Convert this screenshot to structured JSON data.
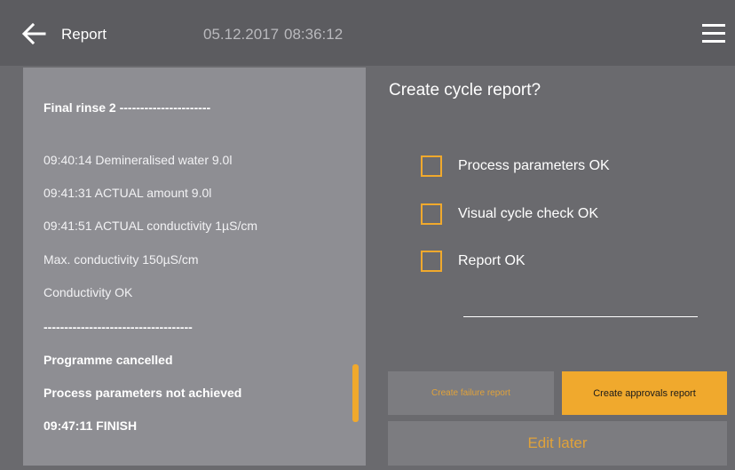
{
  "header": {
    "title": "Report",
    "date": "05.12.2017",
    "time": "08:36:12",
    "back_icon": "arrow-left-icon",
    "menu_icon": "hamburger-menu-icon"
  },
  "log": {
    "lines": [
      {
        "text": "Final rinse 2 ----------------------",
        "bold": true
      },
      {
        "text": "09:40:14 Demineralised water 9.0l",
        "bold": false
      },
      {
        "text": "09:41:31 ACTUAL amount 9.0l",
        "bold": false
      },
      {
        "text": "09:41:51 ACTUAL conductivity 1µS/cm",
        "bold": false
      },
      {
        "text": "Max. conductivity 150µS/cm",
        "bold": false
      },
      {
        "text": "Conductivity OK",
        "bold": false
      },
      {
        "text": "------------------------------------",
        "bold": true
      },
      {
        "text": "Programme cancelled",
        "bold": true
      },
      {
        "text": "Process parameters not achieved",
        "bold": true
      },
      {
        "text": "09:47:11 FINISH",
        "bold": true
      }
    ]
  },
  "dialog": {
    "question": "Create cycle report?",
    "checks": [
      {
        "label": "Process parameters OK",
        "checked": false
      },
      {
        "label": "Visual cycle check OK",
        "checked": false
      },
      {
        "label": "Report OK",
        "checked": false
      }
    ]
  },
  "buttons": {
    "failure": "Create failure report",
    "approvals": "Create approvals report",
    "edit_later": "Edit later"
  },
  "colors": {
    "accent": "#f0a92d",
    "header_bg": "#5c5c60",
    "background": "#6a6a6e",
    "panel_bg": "#8e8e93"
  }
}
